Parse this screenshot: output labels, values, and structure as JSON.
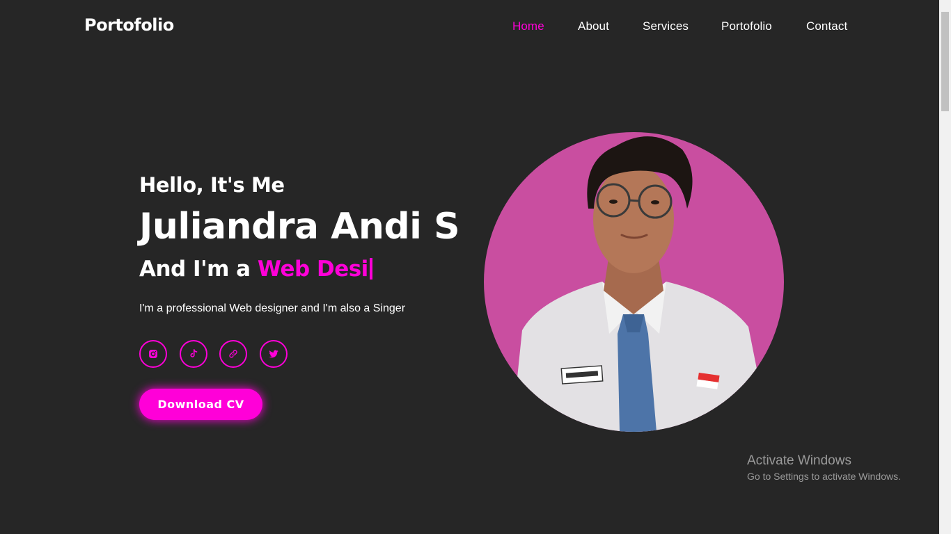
{
  "header": {
    "logo": "Portofolio",
    "nav": [
      {
        "label": "Home",
        "active": true
      },
      {
        "label": "About",
        "active": false
      },
      {
        "label": "Services",
        "active": false
      },
      {
        "label": "Portofolio",
        "active": false
      },
      {
        "label": "Contact",
        "active": false
      }
    ]
  },
  "hero": {
    "greeting": "Hello, It's Me",
    "name": "Juliandra Andi S",
    "role_prefix": "And I'm a ",
    "role_typed": "Web Desi",
    "description": "I'm a professional Web designer and I'm also a Singer",
    "socials": [
      {
        "icon": "instagram-icon"
      },
      {
        "icon": "tiktok-icon"
      },
      {
        "icon": "link-icon"
      },
      {
        "icon": "twitter-icon"
      }
    ],
    "cta": "Download CV",
    "photo_alt": "profile-photo"
  },
  "watermark": {
    "title": "Activate Windows",
    "subtitle": "Go to Settings to activate Windows."
  },
  "colors": {
    "accent": "#ff00d8",
    "background": "#262626",
    "photo_circle": "#c94ea0"
  }
}
